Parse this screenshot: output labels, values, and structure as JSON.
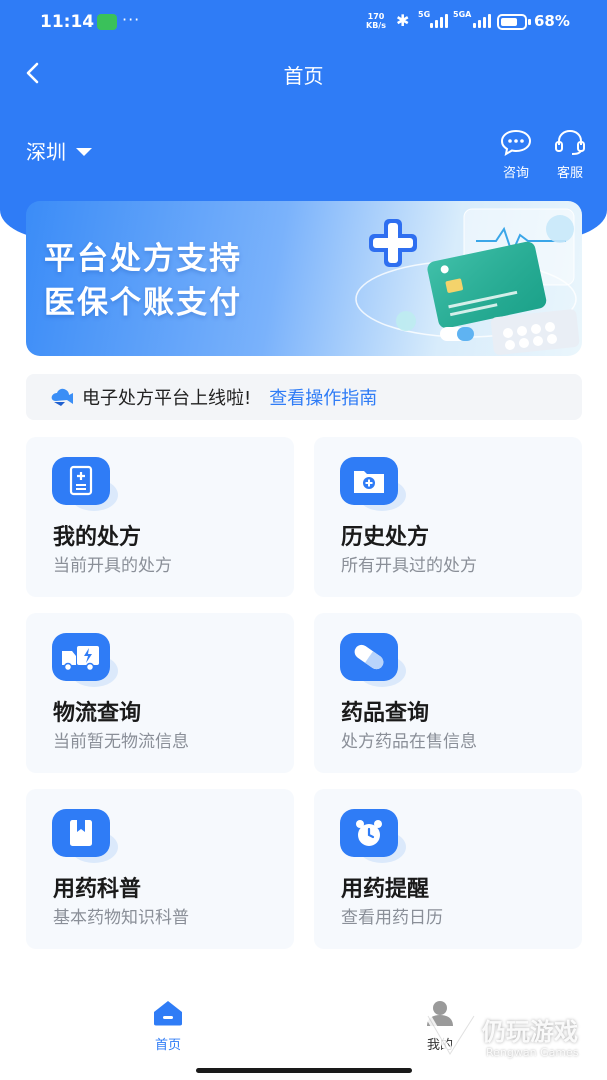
{
  "status_bar": {
    "time": "11:14",
    "dots": "···",
    "speed_value": "170",
    "speed_unit": "KB/s",
    "bluetooth": "✱",
    "signal1_label": "5G",
    "signal2_label": "5GA",
    "battery": "68%"
  },
  "header": {
    "title": "首页",
    "back_icon": "chevron-left-icon"
  },
  "location": {
    "city": "深圳"
  },
  "top_actions": [
    {
      "label": "咨询",
      "icon": "chat-bubble-icon"
    },
    {
      "label": "客服",
      "icon": "headset-icon"
    }
  ],
  "banner": {
    "line1": "平台处方支持",
    "line2": "医保个账支付"
  },
  "notice": {
    "text": "电子处方平台上线啦!",
    "link": "查看操作指南",
    "icon": "cloud-megaphone-icon"
  },
  "cards": [
    {
      "title": "我的处方",
      "subtitle": "当前开具的处方",
      "icon": "prescription-icon"
    },
    {
      "title": "历史处方",
      "subtitle": "所有开具过的处方",
      "icon": "medical-folder-icon"
    },
    {
      "title": "物流查询",
      "subtitle": "当前暂无物流信息",
      "icon": "delivery-truck-icon"
    },
    {
      "title": "药品查询",
      "subtitle": "处方药品在售信息",
      "icon": "pill-icon"
    },
    {
      "title": "用药科普",
      "subtitle": "基本药物知识科普",
      "icon": "bookmark-book-icon"
    },
    {
      "title": "用药提醒",
      "subtitle": "查看用药日历",
      "icon": "alarm-clock-icon"
    }
  ],
  "tabbar": [
    {
      "label": "首页",
      "icon": "home-icon",
      "active": true
    },
    {
      "label": "我的",
      "icon": "user-icon",
      "active": false
    }
  ],
  "watermark": {
    "main": "仍玩游戏",
    "sub": "Rengwan Games"
  },
  "colors": {
    "primary": "#2f7cf6",
    "card_bg": "#f6f9fd",
    "notice_bg": "#f3f5f8",
    "subtitle": "#8a8f98"
  }
}
